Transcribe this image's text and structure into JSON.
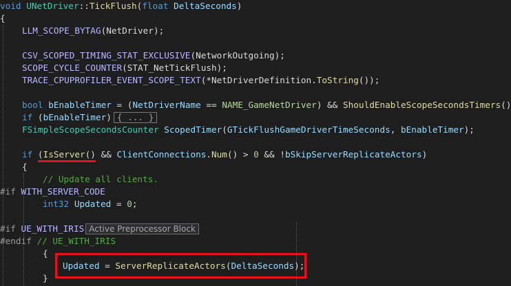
{
  "code": {
    "l1": {
      "kw_void": "void",
      "cls": "UNetDriver",
      "sep": "::",
      "fn": "TickFlush",
      "open": "(",
      "kw_float": "float",
      "param": " DeltaSeconds",
      "close": ")"
    },
    "l2": {
      "brace": "{"
    },
    "l3": {
      "macro": "LLM_SCOPE_BYTAG",
      "args": "(NetDriver);"
    },
    "l4": {
      "macro": "CSV_SCOPED_TIMING_STAT_EXCLUSIVE",
      "args": "(NetworkOutgoing);"
    },
    "l5": {
      "macro": "SCOPE_CYCLE_COUNTER",
      "args": "(STAT_NetTickFlush);"
    },
    "l6": {
      "macro": "TRACE_CPUPROFILER_EVENT_SCOPE_TEXT",
      "args_a": "(*NetDriverDefinition.",
      "fn": "ToString",
      "args_b": "());"
    },
    "l7": {
      "kw_bool": "bool",
      "var": " bEnableTimer",
      "a": " = (",
      "var2": "NetDriverName",
      "b": " == ",
      "en": "NAME_GameNetDriver",
      "c": ") && ",
      "fn": "ShouldEnableScopeSecondsTimers",
      "d": "();"
    },
    "l8": {
      "kw_if": "if",
      "a": " (",
      "var": "bEnableTimer",
      "b": ")",
      "collapsed": "{ ... }"
    },
    "l9": {
      "type": "FSimpleScopeSecondsCounter",
      "var": " ScopedTimer",
      "a": "(",
      "var2": "GTickFlushGameDriverTimeSeconds",
      "b": ", ",
      "var3": "bEnableTimer",
      "c": ");"
    },
    "l10": {
      "kw_if": "if",
      "a": " (",
      "fn": "IsServer",
      "b": "() && ",
      "var": "ClientConnections",
      "c": ".",
      "fn2": "Num",
      "d": "() > ",
      "num": "0",
      "e": " && !",
      "var2": "bSkipServerReplicateActors",
      "f": ")"
    },
    "l11": {
      "brace": "{"
    },
    "l12": {
      "comment": "// Update all clients."
    },
    "l13": {
      "directive": "#if",
      "macro": " WITH_SERVER_CODE"
    },
    "l14": {
      "kw_int": "int32",
      "var": " Updated",
      "a": " = ",
      "num": "0",
      "b": ";"
    },
    "l15": {
      "directive": "#if",
      "macro": " UE_WITH_IRIS",
      "tooltip": "Active Preprocessor Block"
    },
    "l16": {
      "directive": "#endif",
      "comment": " // UE_WITH_IRIS"
    },
    "l17": {
      "brace": "{"
    },
    "l18": {
      "var": "Updated",
      "a": " = ",
      "fn": "ServerReplicateActors",
      "b": "(",
      "var2": "DeltaSeconds",
      "c": ");"
    },
    "l19": {
      "brace": "}"
    }
  },
  "colors": {
    "background": "#1e1e1e",
    "annotation_red": "#e8101a"
  }
}
